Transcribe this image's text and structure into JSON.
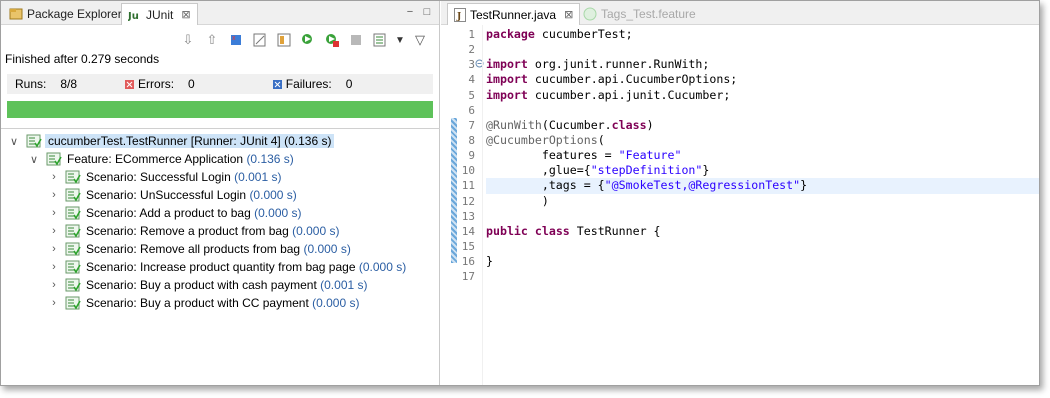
{
  "left_tabs": [
    {
      "label": "Package Explorer",
      "icon": "package-explorer-icon"
    },
    {
      "label": "JUnit",
      "icon": "junit-icon",
      "close": "⊠"
    }
  ],
  "left_tab_controls": {
    "minimize": "−",
    "maximize": "□"
  },
  "status_text": "Finished after 0.279 seconds",
  "counters": {
    "runs_label": "Runs:",
    "runs_value": "8/8",
    "errors_label": "Errors:",
    "errors_value": "0",
    "failures_label": "Failures:",
    "failures_value": "0"
  },
  "progress": {
    "fraction": 1.0,
    "color": "#5ec25a"
  },
  "tree": {
    "root": {
      "label": "cucumberTest.TestRunner [Runner: JUnit 4]",
      "time": "(0.136 s)"
    },
    "feature": {
      "label": "Feature: ECommerce Application",
      "time": "(0.136 s)"
    },
    "scenarios": [
      {
        "label": "Scenario: Successful Login",
        "time": "(0.001 s)"
      },
      {
        "label": "Scenario: UnSuccessful Login",
        "time": "(0.000 s)"
      },
      {
        "label": "Scenario: Add a product to bag",
        "time": "(0.000 s)"
      },
      {
        "label": "Scenario: Remove a product from bag",
        "time": "(0.000 s)"
      },
      {
        "label": "Scenario: Remove all products from bag",
        "time": "(0.000 s)"
      },
      {
        "label": "Scenario: Increase product quantity from bag page",
        "time": "(0.000 s)"
      },
      {
        "label": "Scenario: Buy a product with cash payment",
        "time": "(0.001 s)"
      },
      {
        "label": "Scenario: Buy a product with CC payment",
        "time": "(0.000 s)"
      }
    ]
  },
  "editor_tabs": [
    {
      "label": "TestRunner.java",
      "close": "⊠"
    },
    {
      "label": "Tags_Test.feature"
    }
  ],
  "line_numbers": [
    "1",
    "2",
    "3",
    "4",
    "5",
    "6",
    "7",
    "8",
    "9",
    "10",
    "11",
    "12",
    "13",
    "14",
    "15",
    "16",
    "17"
  ],
  "code_lines": [
    {
      "parts": [
        {
          "t": "package",
          "c": "kw"
        },
        {
          "t": " cucumberTest;",
          "c": ""
        }
      ]
    },
    {
      "parts": []
    },
    {
      "parts": [
        {
          "t": "import",
          "c": "kw"
        },
        {
          "t": " org.junit.runner.RunWith;",
          "c": ""
        }
      ]
    },
    {
      "parts": [
        {
          "t": "import",
          "c": "kw"
        },
        {
          "t": " cucumber.api.CucumberOptions;",
          "c": ""
        }
      ]
    },
    {
      "parts": [
        {
          "t": "import",
          "c": "kw"
        },
        {
          "t": " cucumber.api.junit.Cucumber;",
          "c": ""
        }
      ]
    },
    {
      "parts": []
    },
    {
      "parts": [
        {
          "t": "@RunWith",
          "c": "ann"
        },
        {
          "t": "(Cucumber.",
          "c": ""
        },
        {
          "t": "class",
          "c": "kw"
        },
        {
          "t": ")",
          "c": ""
        }
      ]
    },
    {
      "parts": [
        {
          "t": "@CucumberOptions",
          "c": "ann"
        },
        {
          "t": "(",
          "c": ""
        }
      ]
    },
    {
      "parts": [
        {
          "t": "        features = ",
          "c": ""
        },
        {
          "t": "\"Feature\"",
          "c": "str"
        }
      ]
    },
    {
      "parts": [
        {
          "t": "        ,glue={",
          "c": ""
        },
        {
          "t": "\"stepDefinition\"",
          "c": "str"
        },
        {
          "t": "}",
          "c": ""
        }
      ]
    },
    {
      "parts": [
        {
          "t": "        ,tags = {",
          "c": ""
        },
        {
          "t": "\"@SmokeTest,@RegressionTest\"",
          "c": "str"
        },
        {
          "t": "}",
          "c": ""
        }
      ],
      "highlight": true
    },
    {
      "parts": [
        {
          "t": "        )",
          "c": ""
        }
      ]
    },
    {
      "parts": []
    },
    {
      "parts": [
        {
          "t": "public",
          "c": "kw"
        },
        {
          "t": " ",
          "c": ""
        },
        {
          "t": "class",
          "c": "kw"
        },
        {
          "t": " TestRunner {",
          "c": ""
        }
      ]
    },
    {
      "parts": []
    },
    {
      "parts": [
        {
          "t": "}",
          "c": ""
        }
      ]
    },
    {
      "parts": []
    }
  ]
}
